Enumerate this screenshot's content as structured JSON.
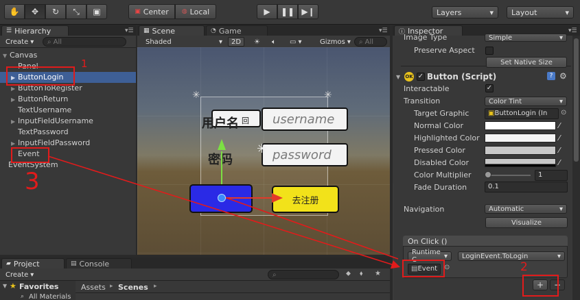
{
  "toolbar": {
    "pivot": "Center",
    "space": "Local",
    "layers": "Layers",
    "layout": "Layout"
  },
  "hierarchy": {
    "tab": "Hierarchy",
    "create": "Create",
    "search_placeholder": "All",
    "items": [
      {
        "label": "Canvas"
      },
      {
        "label": "Panel"
      },
      {
        "label": "ButtonLogin"
      },
      {
        "label": "ButtonToRegister"
      },
      {
        "label": "ButtonReturn"
      },
      {
        "label": "TextUsername"
      },
      {
        "label": "InputFieldUsername"
      },
      {
        "label": "TextPassword"
      },
      {
        "label": "InputFieldPassword"
      },
      {
        "label": "Event"
      },
      {
        "label": "EventSystem"
      }
    ]
  },
  "scene": {
    "tab_scene": "Scene",
    "tab_game": "Game",
    "shading": "Shaded",
    "mode_2d": "2D",
    "gizmos": "Gizmos",
    "search_placeholder": "All",
    "label_username": "用户名",
    "label_username_suffix": "回",
    "input_username": "username",
    "label_password": "密码",
    "input_password": "password",
    "button_register": "去注册"
  },
  "inspector": {
    "tab": "Inspector",
    "image_type_label": "Image Type",
    "image_type_value": "Simple",
    "preserve_aspect": "Preserve Aspect",
    "set_native_size": "Set Native Size",
    "component_title": "Button (Script)",
    "interactable": "Interactable",
    "transition_label": "Transition",
    "transition_value": "Color Tint",
    "target_graphic_label": "Target Graphic",
    "target_graphic_value": "ButtonLogin (In",
    "normal_color": "Normal Color",
    "highlighted_color": "Highlighted Color",
    "pressed_color": "Pressed Color",
    "disabled_color": "Disabled Color",
    "color_multiplier_label": "Color Multiplier",
    "color_multiplier_value": "1",
    "fade_duration_label": "Fade Duration",
    "fade_duration_value": "0.1",
    "navigation_label": "Navigation",
    "navigation_value": "Automatic",
    "visualize": "Visualize",
    "onclick_header": "On Click ()",
    "runtime_value": "Runtime C",
    "function_value": "LoginEvent.ToLogin",
    "event_object": "Event",
    "add_button": "+",
    "remove_button": "−"
  },
  "project": {
    "tab_project": "Project",
    "tab_console": "Console",
    "create": "Create",
    "favorites": "Favorites",
    "all_materials": "All Materials",
    "breadcrumb_root": "Assets",
    "breadcrumb_current": "Scenes"
  },
  "annotations": {
    "mark_one": "1",
    "mark_two": "2",
    "mark_three": "3"
  },
  "colors": {
    "selection": "#3e5f96",
    "annotation_red": "#e21b1b",
    "button_blue": "#2a2ae6",
    "button_yellow": "#f2e21a"
  }
}
